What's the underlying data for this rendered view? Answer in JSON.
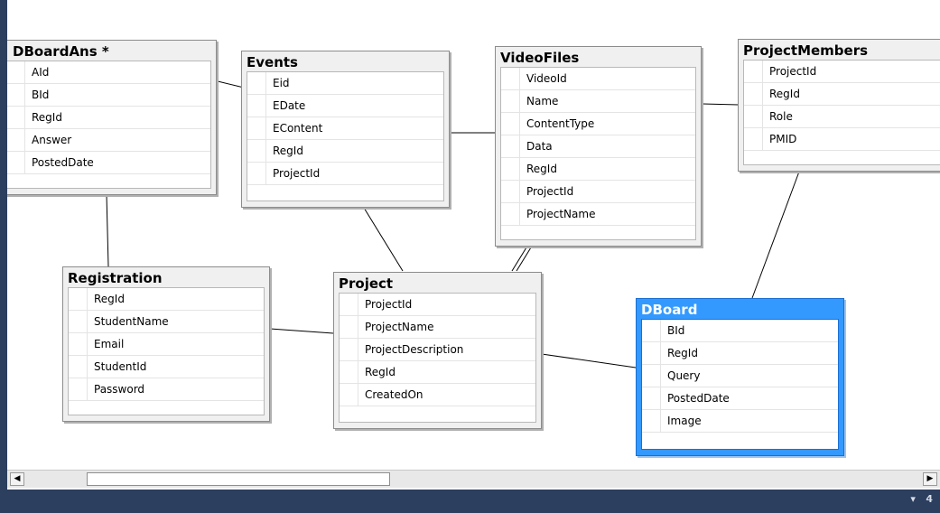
{
  "tables": [
    {
      "id": "dboardans",
      "title": "DBoardAns *",
      "columns": [
        "AId",
        "BId",
        "RegId",
        "Answer",
        "PostedDate"
      ]
    },
    {
      "id": "events",
      "title": "Events",
      "columns": [
        "Eid",
        "EDate",
        "EContent",
        "RegId",
        "ProjectId"
      ]
    },
    {
      "id": "videofiles",
      "title": "VideoFiles",
      "columns": [
        "VideoId",
        "Name",
        "ContentType",
        "Data",
        "RegId",
        "ProjectId",
        "ProjectName"
      ]
    },
    {
      "id": "projectmembers",
      "title": "ProjectMembers",
      "columns": [
        "ProjectId",
        "RegId",
        "Role",
        "PMID"
      ]
    },
    {
      "id": "registration",
      "title": "Registration",
      "columns": [
        "RegId",
        "StudentName",
        "Email",
        "StudentId",
        "Password"
      ]
    },
    {
      "id": "project",
      "title": "Project",
      "columns": [
        "ProjectId",
        "ProjectName",
        "ProjectDescription",
        "RegId",
        "CreatedOn"
      ]
    },
    {
      "id": "dboard",
      "title": "DBoard",
      "columns": [
        "BId",
        "RegId",
        "Query",
        "PostedDate",
        "Image"
      ]
    }
  ],
  "selected_table": "dboard",
  "colors": {
    "selection_accent": "#3399ff",
    "status_bar": "#2d3f5e"
  },
  "icons": {
    "scroll_left": "arrow-left-icon",
    "scroll_right": "arrow-right-icon",
    "status": [
      "dropdown-arrow-icon",
      "pin-icon"
    ]
  }
}
